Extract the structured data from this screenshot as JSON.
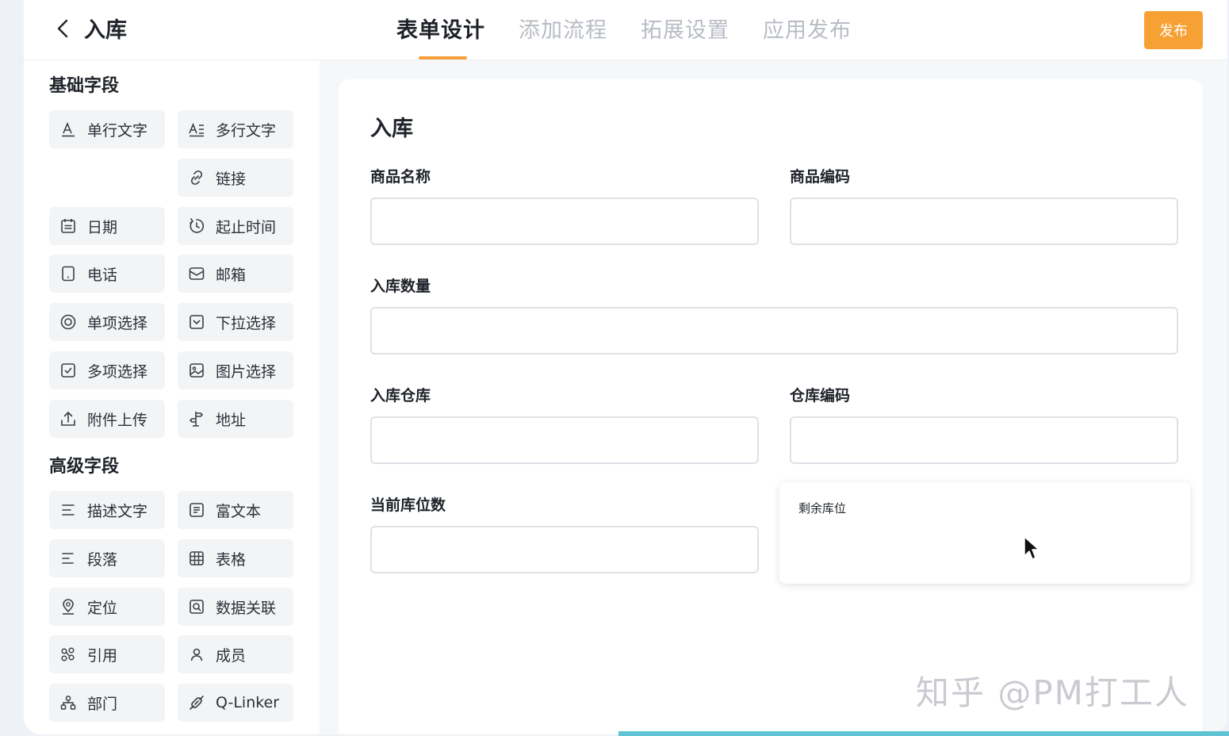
{
  "header": {
    "title": "入库",
    "tabs": [
      {
        "label": "表单设计",
        "active": true
      },
      {
        "label": "添加流程",
        "active": false
      },
      {
        "label": "拓展设置",
        "active": false
      },
      {
        "label": "应用发布",
        "active": false
      }
    ],
    "publish_label": "发布",
    "accent_color": "#f7a034"
  },
  "sidebar": {
    "basic_title": "基础字段",
    "basic_fields": [
      {
        "label": "单行文字",
        "icon": "text-a-icon"
      },
      {
        "label": "多行文字",
        "icon": "multiline-text-icon"
      },
      {
        "label": "链接",
        "icon": "link-icon"
      },
      {
        "label": "日期",
        "icon": "calendar-icon"
      },
      {
        "label": "起止时间",
        "icon": "time-range-icon"
      },
      {
        "label": "电话",
        "icon": "phone-icon"
      },
      {
        "label": "邮箱",
        "icon": "mail-icon"
      },
      {
        "label": "单项选择",
        "icon": "radio-icon"
      },
      {
        "label": "下拉选择",
        "icon": "dropdown-icon"
      },
      {
        "label": "多项选择",
        "icon": "checkbox-icon"
      },
      {
        "label": "图片选择",
        "icon": "image-icon"
      },
      {
        "label": "附件上传",
        "icon": "upload-icon"
      },
      {
        "label": "地址",
        "icon": "address-icon"
      }
    ],
    "advanced_title": "高级字段",
    "advanced_fields": [
      {
        "label": "描述文字",
        "icon": "description-icon"
      },
      {
        "label": "富文本",
        "icon": "rich-text-icon"
      },
      {
        "label": "段落",
        "icon": "paragraph-icon"
      },
      {
        "label": "表格",
        "icon": "table-icon"
      },
      {
        "label": "定位",
        "icon": "location-icon"
      },
      {
        "label": "数据关联",
        "icon": "data-link-icon"
      },
      {
        "label": "引用",
        "icon": "reference-icon"
      },
      {
        "label": "成员",
        "icon": "member-icon"
      },
      {
        "label": "部门",
        "icon": "department-icon"
      },
      {
        "label": "Q-Linker",
        "icon": "q-linker-icon"
      }
    ]
  },
  "form": {
    "title": "入库",
    "fields": [
      {
        "label": "商品名称",
        "value": ""
      },
      {
        "label": "商品编码",
        "value": ""
      },
      {
        "label": "入库数量",
        "value": ""
      },
      {
        "label": "入库仓库",
        "value": ""
      },
      {
        "label": "仓库编码",
        "value": ""
      },
      {
        "label": "当前库位数",
        "value": ""
      }
    ],
    "dragging_field": {
      "label": "剩余库位"
    }
  },
  "watermark": "知乎 @PM打工人"
}
